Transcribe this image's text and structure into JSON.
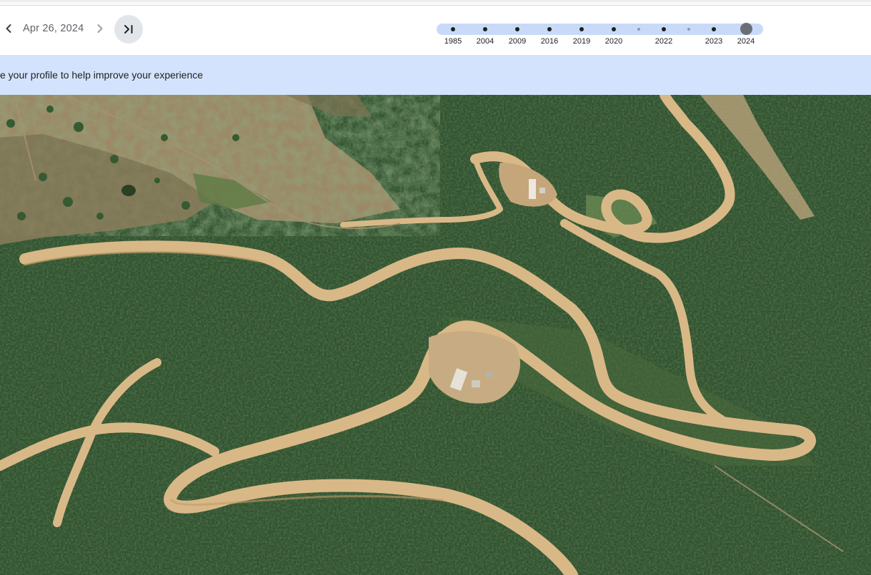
{
  "nav": {
    "prev_icon": "chevron-left-icon",
    "next_icon": "chevron-right-icon",
    "date": "Apr 26, 2024",
    "latest_icon": "skip-to-latest-icon"
  },
  "timeline": {
    "years": [
      {
        "label": "1985",
        "major": true
      },
      {
        "label": "2004",
        "major": true
      },
      {
        "label": "2009",
        "major": true
      },
      {
        "label": "2016",
        "major": true
      },
      {
        "label": "2019",
        "major": true
      },
      {
        "label": "2020",
        "major": true
      },
      {
        "label": "",
        "major": false
      },
      {
        "label": "2022",
        "major": true
      },
      {
        "label": "",
        "major": false
      },
      {
        "label": "2023",
        "major": true
      },
      {
        "label": "2024",
        "major": true,
        "selected": true
      }
    ]
  },
  "banner": {
    "text": "e your profile to help improve your experience"
  },
  "colors": {
    "banner_bg": "#d3e3fd",
    "timeline_track": "#c9daf8",
    "forest": "#2f4f2c",
    "road": "#d8b88a",
    "dry_grass": "#9e8a66"
  }
}
